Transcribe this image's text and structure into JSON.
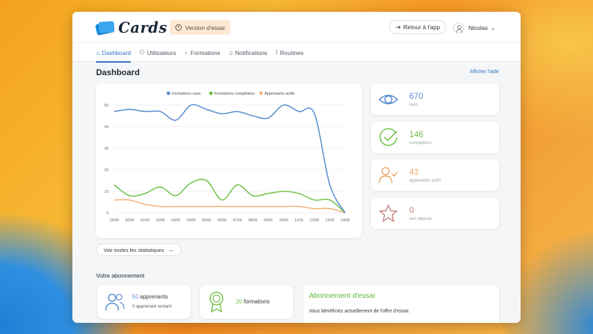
{
  "app": {
    "logo_text": "Cards"
  },
  "topbar": {
    "trial_badge": "Version d'essai",
    "back_button": "Retour à l'app",
    "user_name": "Nicolas"
  },
  "nav": {
    "items": [
      {
        "label": "Dashboard",
        "icon": "home-icon"
      },
      {
        "label": "Utilisateurs",
        "icon": "users-icon"
      },
      {
        "label": "Formations",
        "icon": "award-icon"
      },
      {
        "label": "Notifications",
        "icon": "bell-icon"
      },
      {
        "label": "Routines",
        "icon": "routine-icon"
      }
    ]
  },
  "page": {
    "title": "Dashboard",
    "help_link": "Afficher l'aide"
  },
  "chart_data": {
    "type": "line",
    "x": [
      "29/04",
      "30/04",
      "01/05",
      "02/05",
      "03/05",
      "04/05",
      "05/05",
      "06/05",
      "07/05",
      "08/05",
      "09/05",
      "10/05",
      "11/05",
      "12/05",
      "13/05",
      "14/05"
    ],
    "yticks": [
      0,
      10,
      20,
      30,
      40,
      50
    ],
    "ylim": [
      0,
      50
    ],
    "legend_position": "top-center",
    "grid": true,
    "series": [
      {
        "name": "Formations vues",
        "color": "#5b8fd0",
        "values": [
          47,
          48,
          47,
          47,
          43,
          50,
          48,
          46,
          47,
          45,
          44,
          50,
          47,
          46,
          13,
          0
        ]
      },
      {
        "name": "Formations complétées",
        "color": "#72c04a",
        "values": [
          13,
          8,
          9,
          12,
          8,
          14,
          15,
          6,
          13,
          8,
          9,
          10,
          9,
          6,
          6,
          0
        ]
      },
      {
        "name": "Apprenants actifs",
        "color": "#f0b37a",
        "values": [
          6,
          6,
          4,
          3,
          3,
          3,
          3,
          3,
          3,
          3,
          3,
          3,
          3,
          2,
          2,
          0
        ]
      }
    ]
  },
  "stats": [
    {
      "value": "670",
      "label": "vues",
      "color": "#5b8fd0",
      "icon": "eye-icon"
    },
    {
      "value": "146",
      "label": "complétions",
      "color": "#72c04a",
      "icon": "check-circle-icon"
    },
    {
      "value": "43",
      "label": "apprenants actifs",
      "color": "#e9a866",
      "icon": "user-check-icon"
    },
    {
      "value": "0",
      "label": "avis déposé",
      "color": "#c47c7c",
      "icon": "star-icon"
    }
  ],
  "stats_link": "Voir toutes les statistiques",
  "subscription": {
    "title": "Votre abonnement",
    "learners_count": "50",
    "learners_label": "apprenants",
    "learners_remaining": "0 apprenant restant",
    "formations_count": "20",
    "formations_label": "formations",
    "trial_title": "Abonnement d'essai",
    "trial_desc": "Vous bénéficiez actuellement de l'offre d'essai."
  }
}
